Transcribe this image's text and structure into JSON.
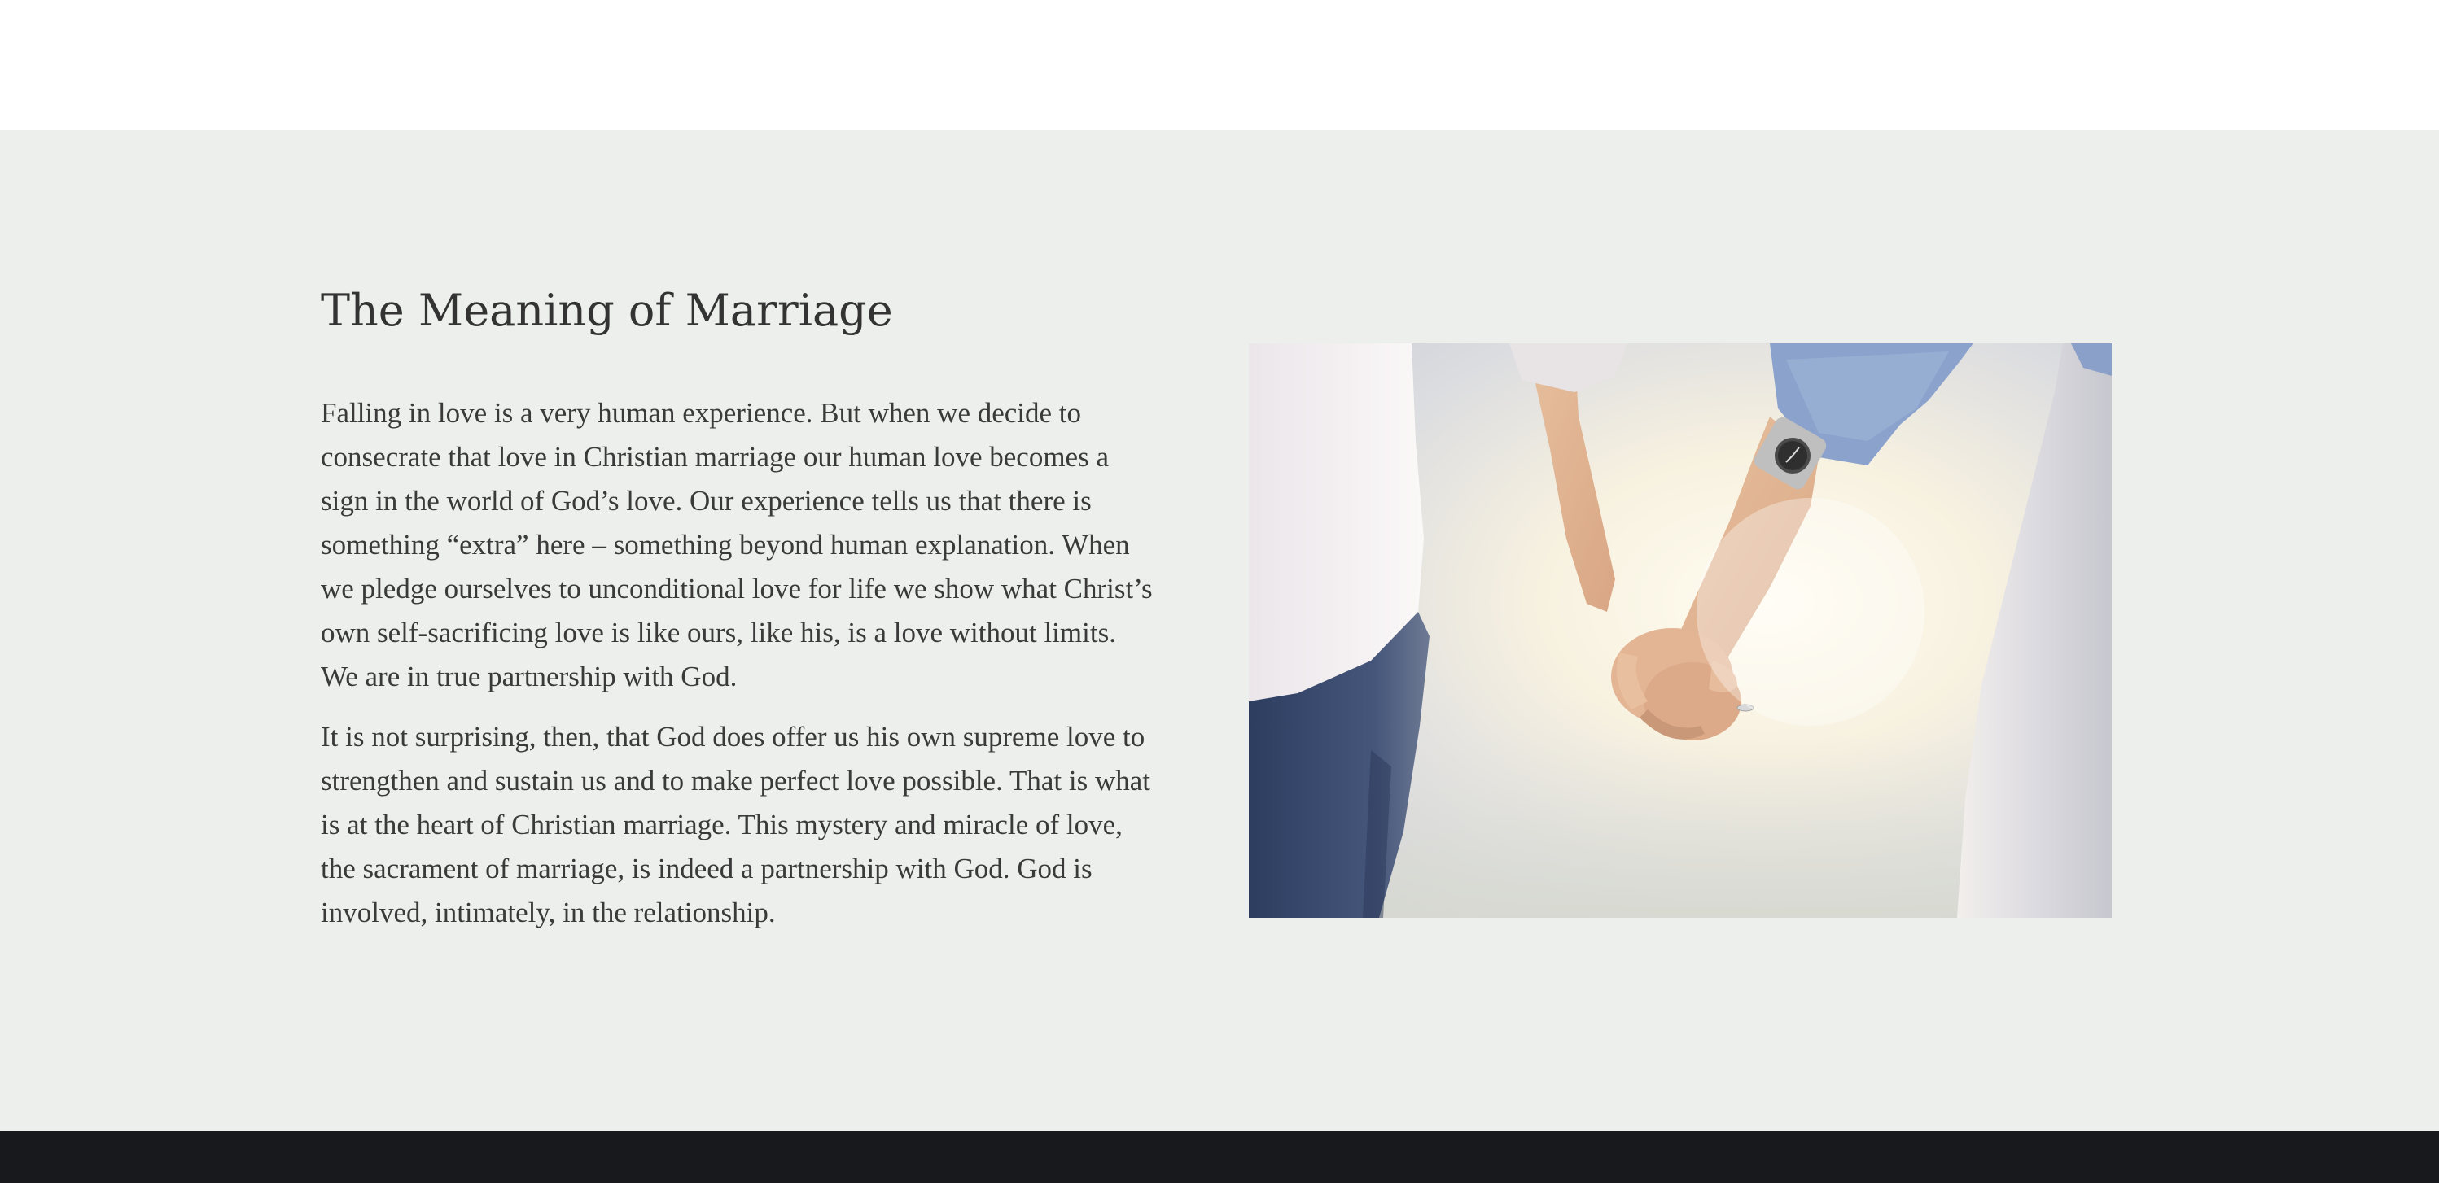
{
  "section": {
    "heading": "The Meaning of Marriage",
    "paragraphs": [
      "Falling in love is a very human experience.  But when we decide to\nconsecrate that love in Christian marriage our human love becomes a\nsign in the world of God’s love.  Our experience tells us that there is\nsomething “extra” here – something beyond human explanation.  When\nwe pledge ourselves to unconditional love for life we show what Christ’s\nown self-sacrificing love is like ours, like his, is a love without limits.\nWe are in true partnership with God.",
      "It is not surprising, then, that God does offer us his own supreme love to\nstrengthen and sustain us and to make perfect love possible.  That is what\nis at the heart of Christian marriage.  This mystery and miracle of love,\nthe sacrament of marriage, is indeed a partnership with God.  God is\ninvolved, intimately, in the relationship."
    ]
  },
  "colors": {
    "section_background": "#edefec",
    "text": "#3a3a3a",
    "footer": "#18191c"
  }
}
